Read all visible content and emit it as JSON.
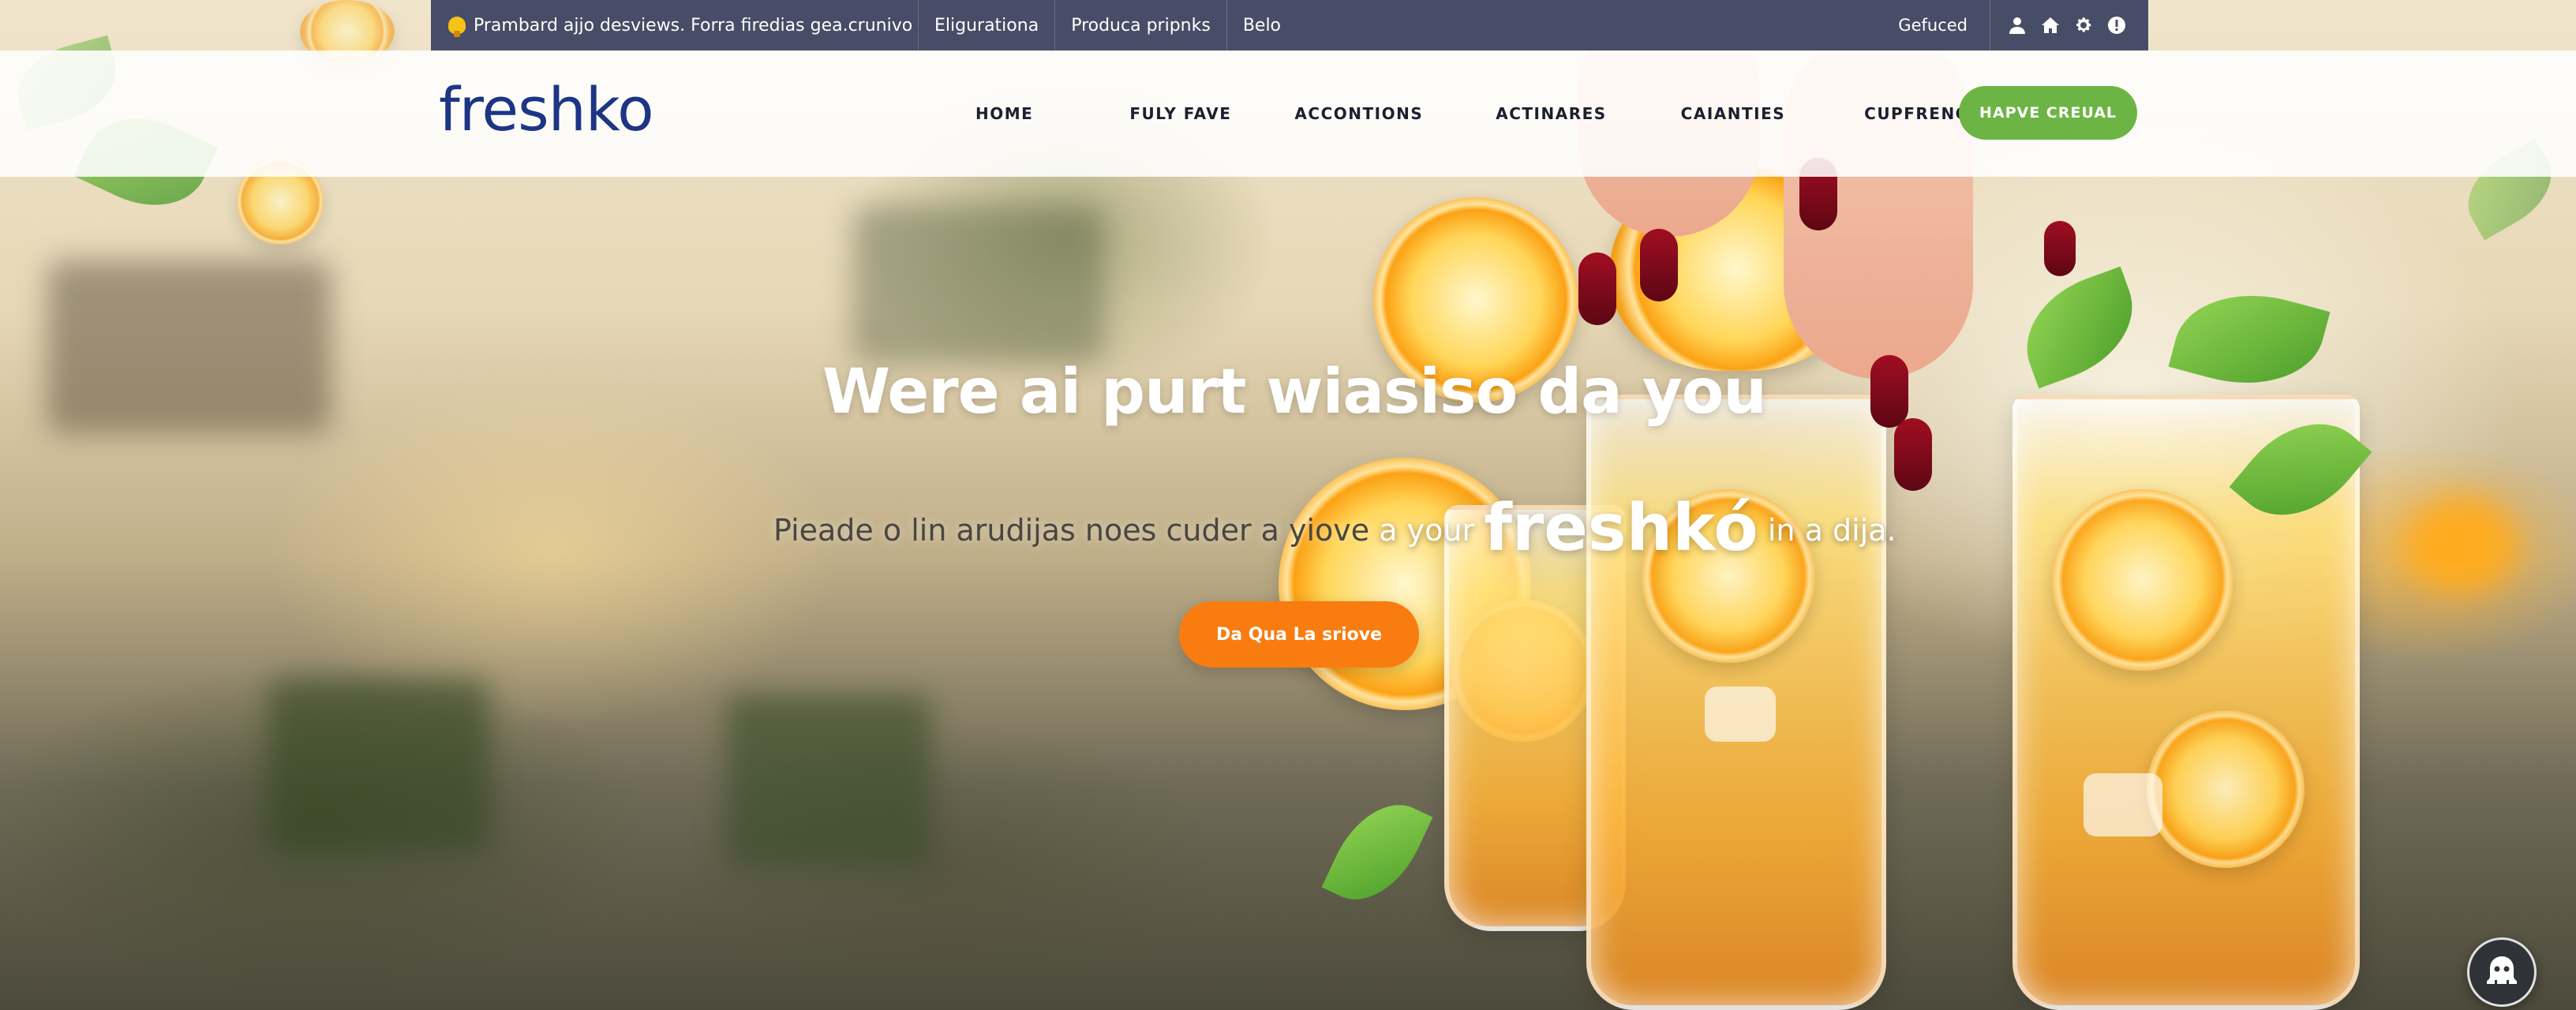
{
  "utility_bar": {
    "promo_icon": "lightbulb-icon",
    "promo_text": "Prambard ajjo desviews. Forra firedias gea.crunivo",
    "links": [
      "Eligurationa",
      "Produca pripnks",
      "Belo"
    ],
    "status": "Gefuced",
    "icons": [
      "user-icon",
      "home-icon",
      "gear-icon",
      "info-icon"
    ]
  },
  "header": {
    "logo": "freshko",
    "nav": [
      "HOME",
      "FULY FAVE",
      "ACCONTIONS",
      "ACTINARES",
      "CAIANTIES",
      "CUPFRENCES"
    ],
    "cta": "HAPVE CREUAL"
  },
  "hero": {
    "title": "Were ai purt wiasiso da you",
    "subtitle_a": "Pieade o lin arudijas noes cuder a yiove",
    "subtitle_b": "a your",
    "brand": "freshkó",
    "subtitle_c": "in a dija.",
    "cta": "Da Qua La sriove"
  },
  "chat": {
    "icon": "chat-avatar-icon"
  },
  "colors": {
    "utility_bg": "#474d66",
    "logo": "#1d3585",
    "header_cta": "#6cb544",
    "hero_cta": "#f97c10"
  }
}
